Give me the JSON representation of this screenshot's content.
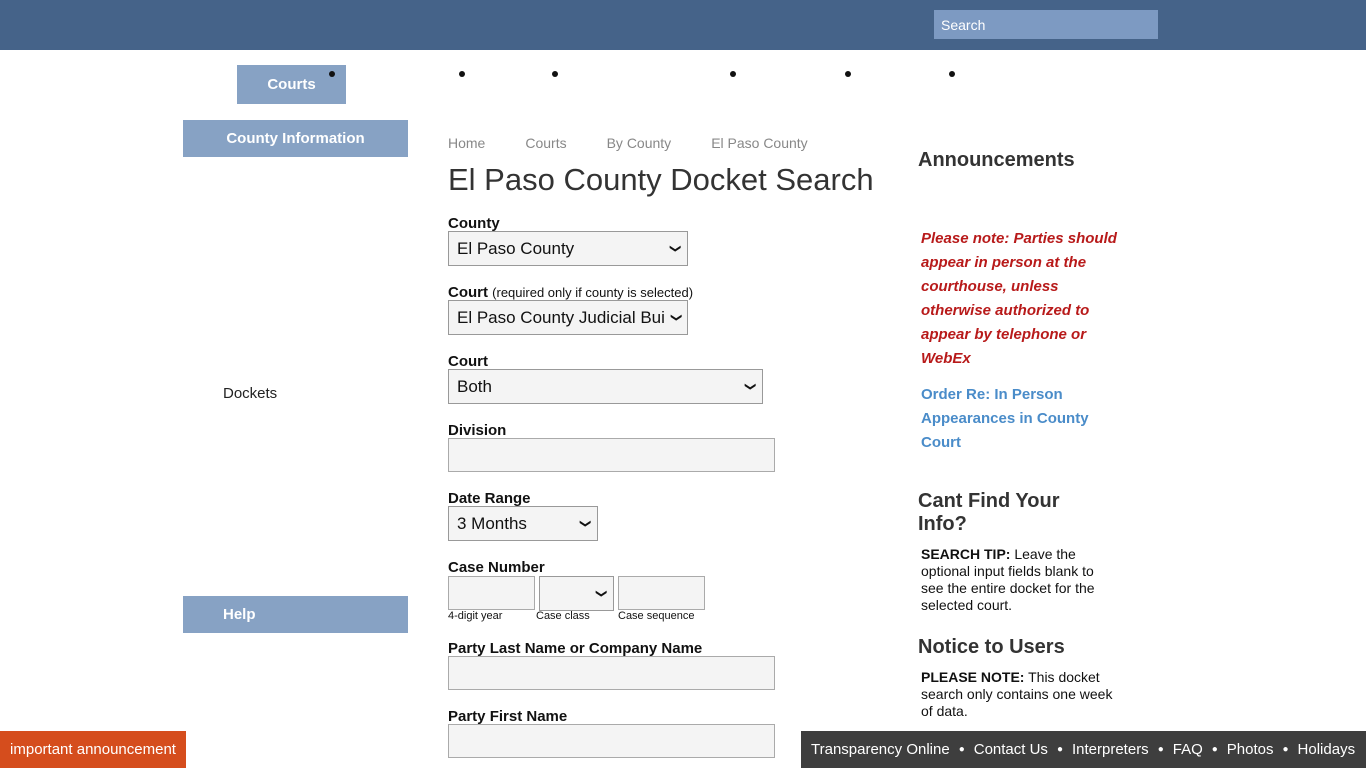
{
  "header": {
    "search_placeholder": "Search",
    "nav_courts": "Courts"
  },
  "sidebar": {
    "county_information": "County Information",
    "dockets": "Dockets",
    "help": "Help"
  },
  "breadcrumb": [
    "Home",
    "Courts",
    "By County",
    "El Paso County"
  ],
  "page_title": "El Paso County Docket Search",
  "form": {
    "county_label": "County",
    "county_value": "El Paso County",
    "court_label": "Court",
    "court_note": "(required only if county is selected)",
    "court_value": "El Paso County Judicial Bui",
    "court2_label": "Court",
    "court2_value": "Both",
    "division_label": "Division",
    "division_value": "",
    "date_range_label": "Date Range",
    "date_range_value": "3 Months",
    "case_number_label": "Case Number",
    "case_year_hint": "4-digit year",
    "case_class_hint": "Case class",
    "case_sequence_hint": "Case sequence",
    "party_last_label": "Party Last Name or Company Name",
    "party_last_value": "",
    "party_first_label": "Party First Name",
    "party_first_value": ""
  },
  "announcements": {
    "title": "Announcements",
    "notice": "Please note:  Parties should appear in person at the courthouse, unless otherwise authorized to appear by telephone or WebEx",
    "order_link": "Order Re:  In Person Appearances in County Court",
    "cant_find_title": "Cant Find Your Info?",
    "search_tip_bold": "SEARCH TIP:",
    "search_tip_text": " Leave the optional input fields blank to see the entire docket for the selected court.",
    "notice_users_title": "Notice to Users",
    "please_note_bold": "PLEASE NOTE:",
    "please_note_text": " This docket search only contains one week of data."
  },
  "important_announcement": "important announcement",
  "footer_links": [
    "Transparency Online",
    "Contact Us",
    "Interpreters",
    "FAQ",
    "Photos",
    "Holidays"
  ],
  "colors": {
    "topbar": "#456389",
    "nav_button": "#87a2c4",
    "notice_red": "#b81a1a",
    "link_blue": "#4a8cc9",
    "important_orange": "#d54d1d",
    "footer_dark": "#3e3e3e"
  }
}
